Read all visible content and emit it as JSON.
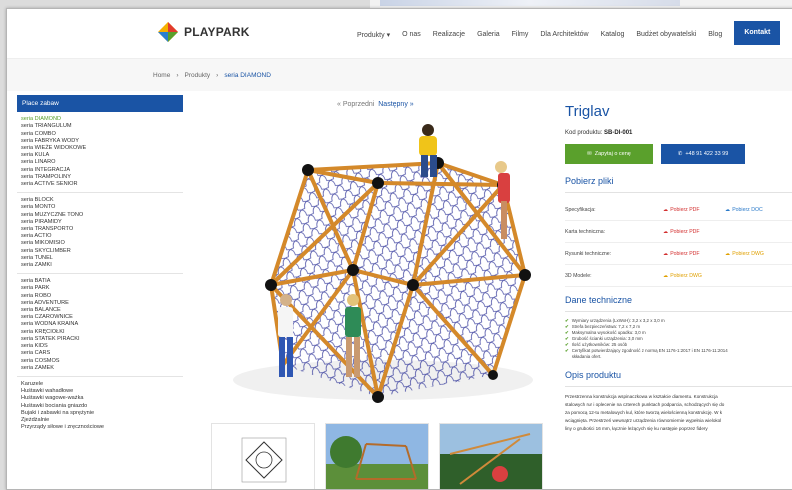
{
  "header": {
    "logo_text": "PLAYPARK",
    "nav": [
      "Produkty ▾",
      "O nas",
      "Realizacje",
      "Galeria",
      "Filmy",
      "Dla Architektów",
      "Katalog",
      "Budżet obywatelski",
      "Blog"
    ],
    "contact": "Kontakt"
  },
  "breadcrumb": {
    "home": "Home",
    "products": "Produkty",
    "current": "seria DIAMOND"
  },
  "sidebar": {
    "heading": "Place zabaw",
    "group1": [
      "seria DIAMOND",
      "seria TRIANGULUM",
      "seria COMBO",
      "seria FABRYKA WODY",
      "seria WIEŻE WIDOKOWE",
      "seria KULA",
      "seria LINARO",
      "seria INTEGRACJA",
      "seria TRAMPOLINY",
      "seria ACTIVE SENIOR"
    ],
    "group2": [
      "seria BLOCK",
      "seria MONTO",
      "seria MUZYCZNE TONO",
      "seria PIRAMIDY",
      "seria TRANSPORTO",
      "seria ACTIO",
      "seria MIKOMISIO",
      "seria SKYCLIMBER",
      "seria TUNEL",
      "seria ZAMKI"
    ],
    "group3": [
      "seria BATIA",
      "seria PARK",
      "seria ROBO",
      "seria ADVENTURE",
      "seria BALANCE",
      "seria CZAROWNICE",
      "seria WODNA KRAINA",
      "seria KRĘCIOŁKI",
      "seria STATEK PIRACKI",
      "seria KIDS",
      "seria CARS",
      "seria COSMOS",
      "seria ZAMEK"
    ],
    "group4": [
      "Karuzele",
      "Huśtawki wahadłowe",
      "Huśtawki wagowe-ważka",
      "Huśtawki bociania gniazdo",
      "Bujaki i zabawki na sprężynie",
      "Zjeżdżalnie",
      "Przyrządy siłowe i zręcznościowe"
    ]
  },
  "pager": {
    "prev": "« Poprzedni",
    "next": "Następny »"
  },
  "product": {
    "title": "Triglav",
    "code_label": "Kod produktu:",
    "code": "SB-DI-001",
    "ask_btn": "Zapytaj o cenę",
    "phone_btn": "+48 91 422 33 99"
  },
  "files": {
    "title": "Pobierz pliki",
    "rows": [
      {
        "label": "Specyfikacja:",
        "a": "Pobierz PDF",
        "b": "Pobierz DOC"
      },
      {
        "label": "Karta techniczna:",
        "a": "Pobierz PDF",
        "b": ""
      },
      {
        "label": "Rysunki techniczne:",
        "a": "Pobierz PDF",
        "b": "Pobierz DWG"
      },
      {
        "label": "3D Modele:",
        "a": "Pobierz DWG",
        "b": ""
      }
    ]
  },
  "tech": {
    "title": "Dane techniczne",
    "items": [
      "Wymiary urządzenia (LxWxH): 3,2 x 3,2 x 3,0 m",
      "Strefa bezpieczeństwa: 7,2 x 7,2 m",
      "Maksymalna wysokość upadku: 3,0 m",
      "Grubość ścianki urządzenia: 3,0 mm",
      "Ilość użytkowników: 25 osób",
      "Certyfikat potwierdzający zgodność z normą EN 1176-1:2017 i EN 1176-11:2014",
      "składania ofert."
    ]
  },
  "description": {
    "title": "Opis produktu",
    "lines": [
      "Przestrzenna konstrukcja wspinaczkowa w kształcie diamentu. Konstrukcja",
      "stalowych rur i oplecenie na czterech punktach podparcia, schodzących się do",
      "za pomocą 12-tu metalowych kul, które tworzą wielościenną konstrukcję. W k",
      "wciągnięta. Przestrzeń wewnątrz urządzenia równomiernie wypełnia wielokol",
      "liny o grubości 16 mm, łącznie leżących się ku następie poprzez fidery"
    ]
  },
  "colors": {
    "brand_blue": "#1a54a5",
    "green": "#5aa02c",
    "pdf_red": "#d32f2f"
  }
}
